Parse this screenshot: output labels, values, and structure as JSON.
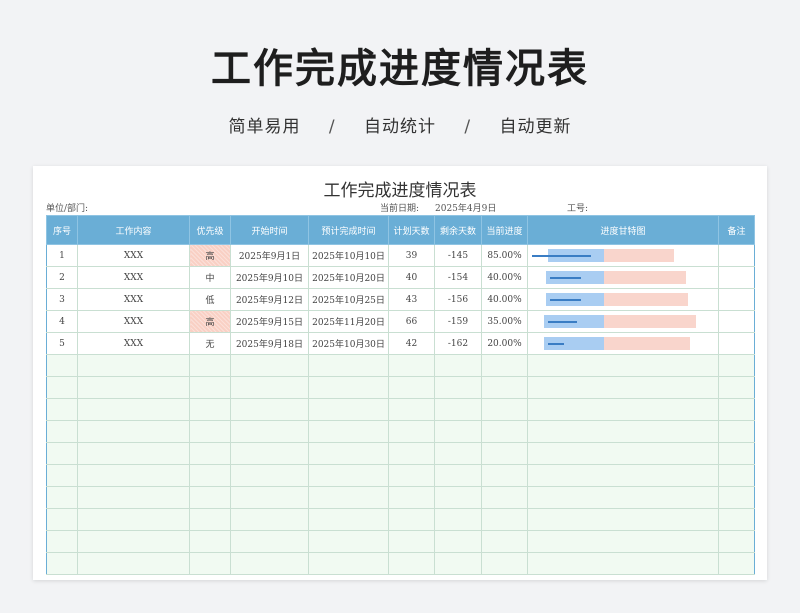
{
  "hero": {
    "title": "工作完成进度情况表",
    "tags": [
      "简单易用",
      "自动统计",
      "自动更新"
    ],
    "separator": "/"
  },
  "sheet": {
    "title": "工作完成进度情况表",
    "unit_label": "单位/部门:",
    "date_label": "当前日期:",
    "date_value": "2025年4月9日",
    "id_label": "工号:"
  },
  "table": {
    "headers": [
      "序号",
      "工作内容",
      "优先级",
      "开始时间",
      "预计完成时间",
      "计划天数",
      "剩余天数",
      "当前进度",
      "进度甘特图",
      "备注"
    ],
    "rows": [
      {
        "no": "1",
        "content": "XXX",
        "priority": "高",
        "start": "2025年9月1日",
        "end": "2025年10月10日",
        "plan_days": "39",
        "remain_days": "-145",
        "progress": "85.00%",
        "progress_value": 0.85
      },
      {
        "no": "2",
        "content": "XXX",
        "priority": "中",
        "start": "2025年9月10日",
        "end": "2025年10月20日",
        "plan_days": "40",
        "remain_days": "-154",
        "progress": "40.00%",
        "progress_value": 0.4
      },
      {
        "no": "3",
        "content": "XXX",
        "priority": "低",
        "start": "2025年9月12日",
        "end": "2025年10月25日",
        "plan_days": "43",
        "remain_days": "-156",
        "progress": "40.00%",
        "progress_value": 0.4
      },
      {
        "no": "4",
        "content": "XXX",
        "priority": "高",
        "start": "2025年9月15日",
        "end": "2025年11月20日",
        "plan_days": "66",
        "remain_days": "-159",
        "progress": "35.00%",
        "progress_value": 0.35
      },
      {
        "no": "5",
        "content": "XXX",
        "priority": "无",
        "start": "2025年9月18日",
        "end": "2025年10月30日",
        "plan_days": "42",
        "remain_days": "-162",
        "progress": "20.00%",
        "progress_value": 0.2
      }
    ],
    "empty_rows": 10,
    "high_priority_value": "高"
  },
  "colors": {
    "header_bg": "#6aaed6",
    "empty_row_bg": "#f1faf2",
    "high_priority_bg": "#f9d0c4",
    "gantt_done": "#a9cdf2",
    "gantt_plan": "#f9d5cc",
    "gantt_line": "#3a7dc4"
  }
}
